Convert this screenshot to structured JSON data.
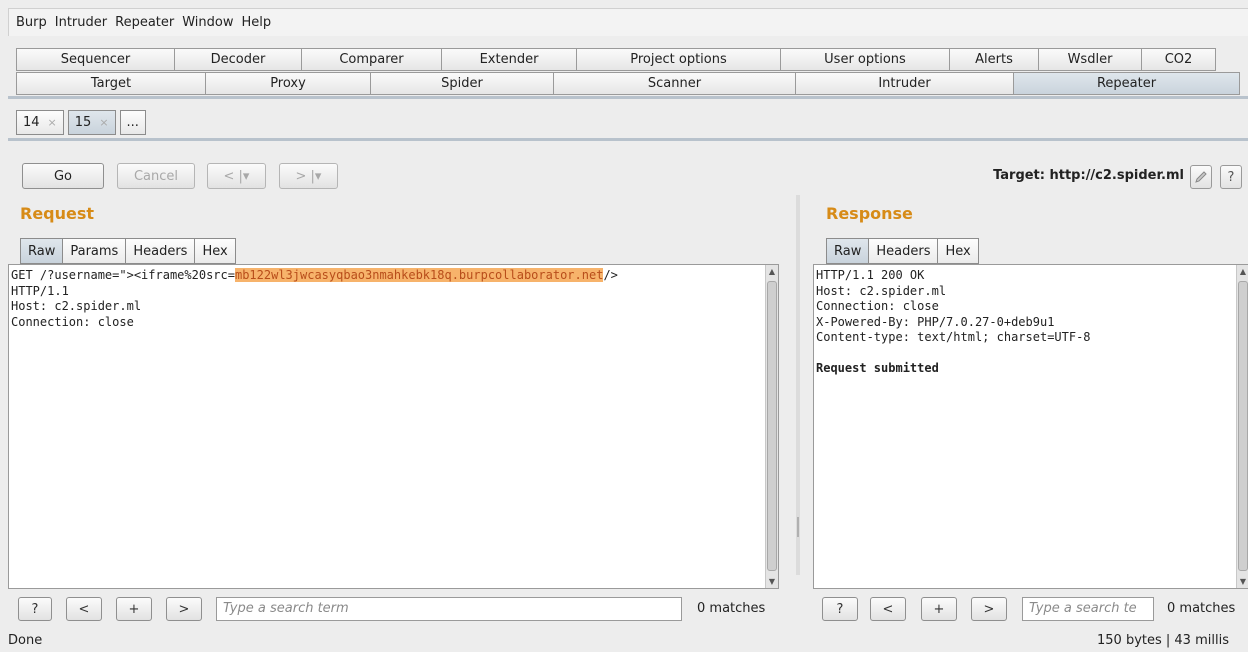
{
  "menu": [
    "Burp",
    "Intruder",
    "Repeater",
    "Window",
    "Help"
  ],
  "tabs_row1": [
    "Sequencer",
    "Decoder",
    "Comparer",
    "Extender",
    "Project options",
    "User options",
    "Alerts",
    "Wsdler",
    "CO2"
  ],
  "tabs_row2": [
    "Target",
    "Proxy",
    "Spider",
    "Scanner",
    "Intruder",
    "Repeater"
  ],
  "subtabs": [
    {
      "label": "14",
      "close": "×"
    },
    {
      "label": "15",
      "close": "×"
    },
    {
      "label": "..."
    }
  ],
  "toolbar": {
    "go": "Go",
    "cancel": "Cancel",
    "back": "< |▾",
    "forward": "> |▾",
    "target_label": "Target: http://c2.spider.ml",
    "edit_icon": "pencil-icon",
    "help": "?"
  },
  "request": {
    "title": "Request",
    "tabs": [
      "Raw",
      "Params",
      "Headers",
      "Hex"
    ],
    "line1_prefix": "GET /?username=\"><iframe%20src=",
    "line1_highlight": "mb122wl3jwcasyqbao3nmahkebk18q.burpcollaborator.net",
    "line1_suffix": "/>",
    "lines": [
      "HTTP/1.1",
      "Host: c2.spider.ml",
      "Connection: close"
    ],
    "search_placeholder": "Type a search term",
    "matches": "0 matches"
  },
  "response": {
    "title": "Response",
    "tabs": [
      "Raw",
      "Headers",
      "Hex"
    ],
    "lines": [
      "HTTP/1.1 200 OK",
      "Host: c2.spider.ml",
      "Connection: close",
      "X-Powered-By: PHP/7.0.27-0+deb9u1",
      "Content-type: text/html; charset=UTF-8",
      ""
    ],
    "body_bold": "Request submitted",
    "search_placeholder": "Type a search tе",
    "matches": "0 matches"
  },
  "search_buttons": [
    "?",
    "<",
    "+",
    ">"
  ],
  "status": {
    "left": "Done",
    "right": "150 bytes | 43 millis"
  },
  "colors": {
    "title_orange": "#d78b17",
    "highlight": "#f7b36b"
  }
}
